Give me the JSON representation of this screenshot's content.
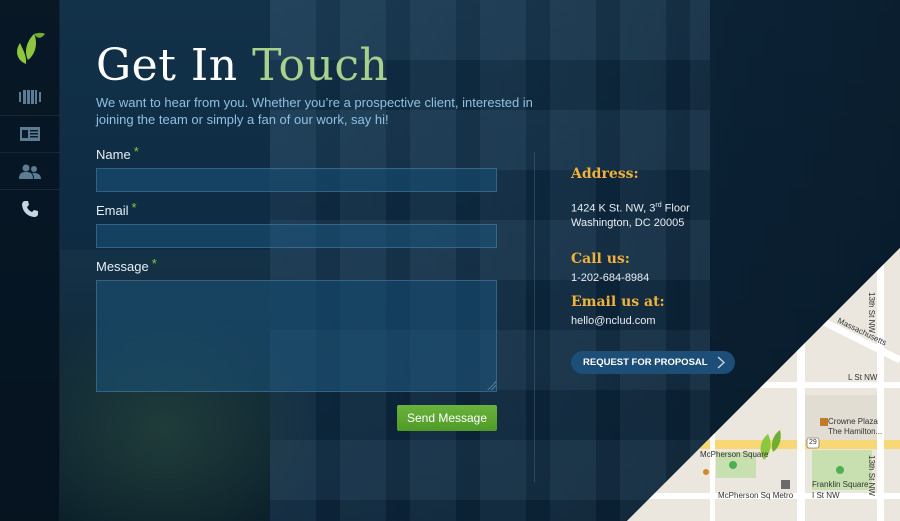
{
  "page": {
    "title_part1": "Get In",
    "title_part2": "Touch",
    "intro": "We want to hear from you. Whether you’re a prospective client, interested in joining the team or simply a fan of our work, say hi!"
  },
  "sidebar": {
    "items": [
      {
        "icon": "work-icon"
      },
      {
        "icon": "about-card-icon"
      },
      {
        "icon": "team-icon"
      },
      {
        "icon": "phone-icon"
      }
    ]
  },
  "form": {
    "name_label": "Name",
    "email_label": "Email",
    "message_label": "Message",
    "required_mark": "*",
    "name_value": "",
    "email_value": "",
    "message_value": "",
    "submit_label": "Send Message"
  },
  "contact": {
    "address_heading": "Address:",
    "address_line1_pre": "1424 K St. NW, 3",
    "address_line1_sup": "rd",
    "address_line1_post": " Floor",
    "address_line2": "Washington, DC 20005",
    "call_heading": "Call us:",
    "phone": "1-202-684-8984",
    "email_heading": "Email us at:",
    "email": "hello@nclud.com",
    "rfp_label": "REQUEST FOR PROPOSAL"
  },
  "map": {
    "labels": {
      "street_13th_top": "13th St NW",
      "massachusetts": "Massachusetts",
      "l_st": "L St NW",
      "crowne1": "Crowne Plaza",
      "crowne2": "The Hamilton...",
      "mcpherson_sq": "McPherson Square",
      "franklin": "Franklin Square",
      "metro": "McPherson Sq Metro",
      "i_st": "I St NW",
      "street_13th_bottom": "13th St NW",
      "route": "29"
    }
  },
  "colors": {
    "accent_green": "#a9d18e",
    "button_green": "#5ba832",
    "heading_gold": "#f0b23a",
    "intro_blue": "#8fc0e0"
  }
}
